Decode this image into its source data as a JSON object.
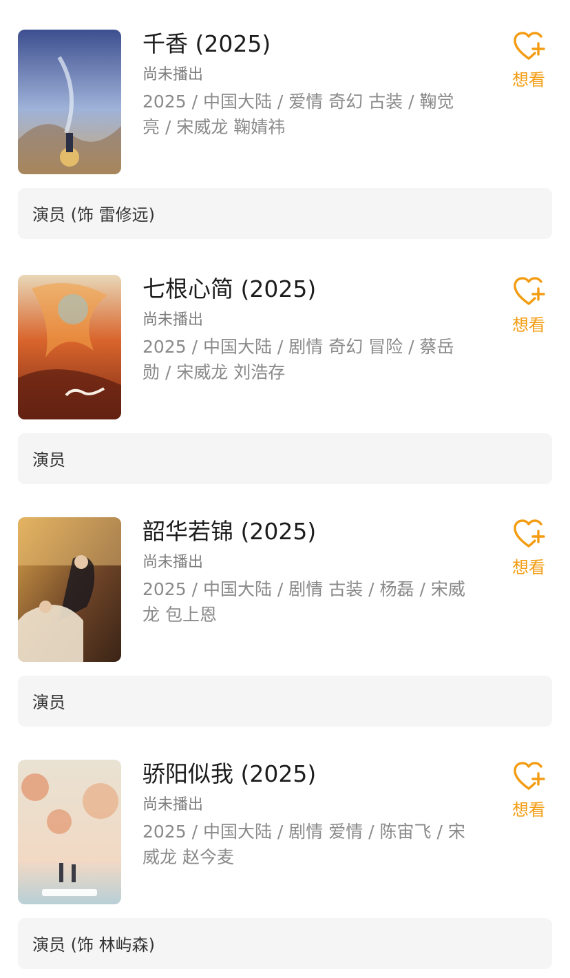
{
  "items": [
    {
      "title": "千香 (2025)",
      "status": "尚未播出",
      "meta": "2025 / 中国大陆 / 爱情 奇幻 古装 / 鞠觉亮 / 宋威龙 鞠婧祎",
      "wish_label": "想看",
      "role": "演员 (饰 雷修远)",
      "poster_colors": [
        "#3d4f8f",
        "#9fb2d8",
        "#c9a870"
      ]
    },
    {
      "title": "七根心简 (2025)",
      "status": "尚未播出",
      "meta": "2025 / 中国大陆 / 剧情 奇幻 冒险 / 蔡岳勋 / 宋威龙 刘浩存",
      "wish_label": "想看",
      "role": "演员",
      "poster_colors": [
        "#7b2a16",
        "#d9652c",
        "#e8d8b8"
      ]
    },
    {
      "title": "韶华若锦 (2025)",
      "status": "尚未播出",
      "meta": "2025 / 中国大陆 / 剧情 古装 / 杨磊 / 宋威龙 包上恩",
      "wish_label": "想看",
      "role": "演员",
      "poster_colors": [
        "#3a2416",
        "#d9a34a",
        "#efe3cf"
      ]
    },
    {
      "title": "骄阳似我 (2025)",
      "status": "尚未播出",
      "meta": "2025 / 中国大陆 / 剧情 爱情 / 陈宙飞 / 宋威龙 赵今麦",
      "wish_label": "想看",
      "role": "演员 (饰 林屿森)",
      "poster_colors": [
        "#e9e2d3",
        "#e07a4a",
        "#b8cfd6"
      ]
    }
  ],
  "accent_color": "#f39c12"
}
